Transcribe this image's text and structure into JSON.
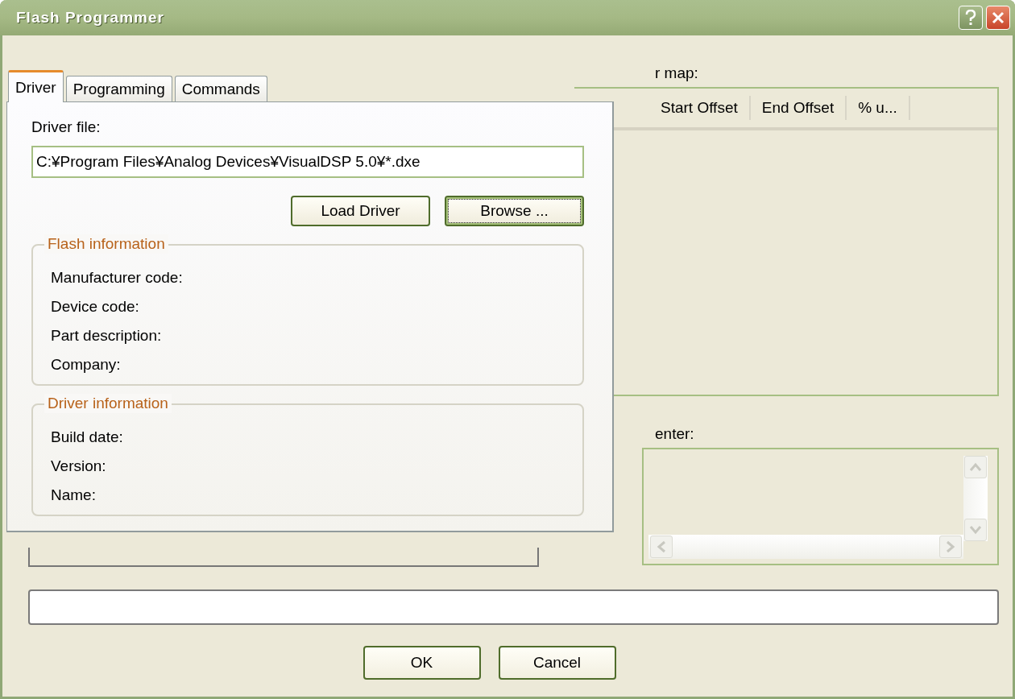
{
  "window": {
    "title": "Flash Programmer"
  },
  "tabs": [
    {
      "label": "Driver",
      "selected": true
    },
    {
      "label": "Programming",
      "selected": false
    },
    {
      "label": "Commands",
      "selected": false
    }
  ],
  "driver_tab": {
    "driver_file_label": "Driver file:",
    "driver_file": "C:¥Program Files¥Analog Devices¥VisualDSP 5.0¥*.dxe",
    "buttons": [
      {
        "label": "Load Driver",
        "focused": false
      },
      {
        "label": "Browse ...",
        "focused": true
      }
    ],
    "groups": [
      {
        "title": "Flash information",
        "fields": [
          "Manufacturer code:",
          "Device code:",
          "Part description:",
          "Company:"
        ]
      },
      {
        "title": "Driver information",
        "fields": [
          "Build date:",
          "Version:",
          "Name:"
        ]
      }
    ]
  },
  "sector_map": {
    "label": "r map:",
    "columns": [
      "Start Offset",
      "End Offset",
      "% u..."
    ]
  },
  "message_center": {
    "label": "enter:"
  },
  "buttons": [
    "OK",
    "Cancel"
  ]
}
